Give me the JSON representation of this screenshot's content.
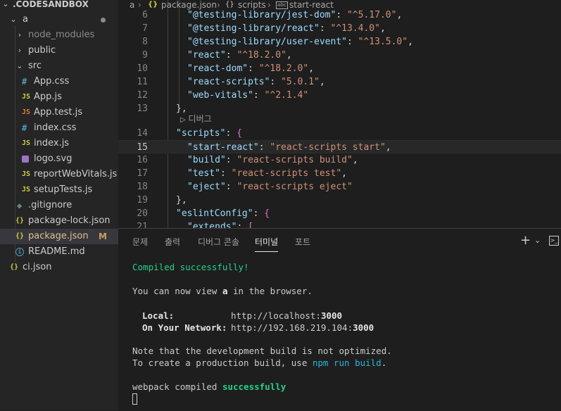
{
  "sidebar": {
    "root": ".CODESANDBOX",
    "folder_a": "a",
    "items": {
      "node_modules": "node_modules",
      "public": "public",
      "src": "src",
      "app_css": "App.css",
      "app_js": "App.js",
      "app_test": "App.test.js",
      "index_css": "index.css",
      "index_js": "index.js",
      "logo_svg": "logo.svg",
      "report_web_vitals": "reportWebVitals.js",
      "setup_tests": "setupTests.js",
      "gitignore": ".gitignore",
      "package_lock": "package-lock.json",
      "package_json": "package.json",
      "readme": "README.md",
      "ci_json": "ci.json"
    },
    "git_status_modified": "M",
    "icon_labels": {
      "css": "#",
      "js": "JS",
      "json": "{}",
      "info": "i"
    }
  },
  "breadcrumb": {
    "folder": "a",
    "file": "package.json",
    "section": "scripts",
    "symbol": "start-react",
    "json_icon": "{}",
    "symbol_icon": "abc"
  },
  "editor": {
    "codelens": "디버그",
    "lines": [
      {
        "n": "6",
        "key": "\"@testing-library/jest-dom\"",
        "val": "\"^5.17.0\"",
        "tail": ","
      },
      {
        "n": "7",
        "key": "\"@testing-library/react\"",
        "val": "\"^13.4.0\"",
        "tail": ","
      },
      {
        "n": "8",
        "key": "\"@testing-library/user-event\"",
        "val": "\"^13.5.0\"",
        "tail": ","
      },
      {
        "n": "9",
        "key": "\"react\"",
        "val": "\"^18.2.0\"",
        "tail": ","
      },
      {
        "n": "10",
        "key": "\"react-dom\"",
        "val": "\"^18.2.0\"",
        "tail": ","
      },
      {
        "n": "11",
        "key": "\"react-scripts\"",
        "val": "\"5.0.1\"",
        "tail": ","
      },
      {
        "n": "12",
        "key": "\"web-vitals\"",
        "val": "\"^2.1.4\"",
        "tail": ""
      },
      {
        "n": "13",
        "text": "},"
      },
      {
        "n": "14",
        "key": "\"scripts\"",
        "open": "{"
      },
      {
        "n": "15",
        "key": "\"start-react\"",
        "val": "\"react-scripts start\"",
        "tail": ","
      },
      {
        "n": "16",
        "key": "\"build\"",
        "val": "\"react-scripts build\"",
        "tail": ","
      },
      {
        "n": "17",
        "key": "\"test\"",
        "val": "\"react-scripts test\"",
        "tail": ","
      },
      {
        "n": "18",
        "key": "\"eject\"",
        "val": "\"react-scripts eject\"",
        "tail": ""
      },
      {
        "n": "19",
        "text": "},"
      },
      {
        "n": "20",
        "key": "\"eslintConfig\"",
        "open": "{"
      },
      {
        "n": "21",
        "key": "\"extends\"",
        "open": "["
      }
    ]
  },
  "panel": {
    "tabs": [
      "문제",
      "출력",
      "디버그 콘솔",
      "터미널",
      "포트"
    ],
    "active_tab": "터미널",
    "terminal": {
      "compiled": "Compiled successfully!",
      "view_pre": "You can now view ",
      "view_app": "a",
      "view_post": " in the browser.",
      "local_label": "Local:",
      "local_url_pre": "http://localhost:",
      "local_port": "3000",
      "network_label": "On Your Network:",
      "network_url_pre": "http://192.168.219.104:",
      "network_port": "3000",
      "note1": "Note that the development build is not optimized.",
      "note2_pre": "To create a production build, use ",
      "note2_cmd": "npm run build",
      "note2_post": ".",
      "webpack_pre": "webpack compiled ",
      "webpack_status": "successfully"
    }
  },
  "colors": {
    "editor_bg": "#1e1e1e",
    "sidebar_bg": "#252526",
    "json_key": "#9cdcfe",
    "json_string": "#ce9178",
    "terminal_success": "#23d18b",
    "terminal_cmd": "#29b8db",
    "git_modified": "#c5a15a"
  }
}
